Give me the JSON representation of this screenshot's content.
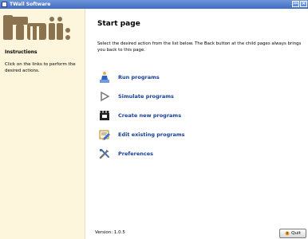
{
  "window": {
    "title": "TWall Software",
    "controls": [
      "—",
      "×"
    ]
  },
  "sidebar": {
    "logo_alt": "twall logo",
    "instructions_heading": "Instructions",
    "instructions_text": "Click on the links to perform the desired actions.",
    "version": "Version: 1.0.5"
  },
  "main": {
    "title": "Start page",
    "description": "Select the desired action from the list below. The Back button at the child pages always brings you back to this page.",
    "actions": [
      {
        "label": "Run programs",
        "icon": "run-programs-icon"
      },
      {
        "label": "Simulate programs",
        "icon": "simulate-programs-icon"
      },
      {
        "label": "Create new programs",
        "icon": "create-programs-icon"
      },
      {
        "label": "Edit existing programs",
        "icon": "edit-programs-icon"
      },
      {
        "label": "Preferences",
        "icon": "preferences-icon"
      }
    ]
  },
  "footer": {
    "quit_label": "Quit"
  },
  "colors": {
    "sidebar_bg": "#fdf6dc",
    "link": "#153d9a",
    "titlebar": "#3f6cc4",
    "logo": "#8b7350"
  }
}
